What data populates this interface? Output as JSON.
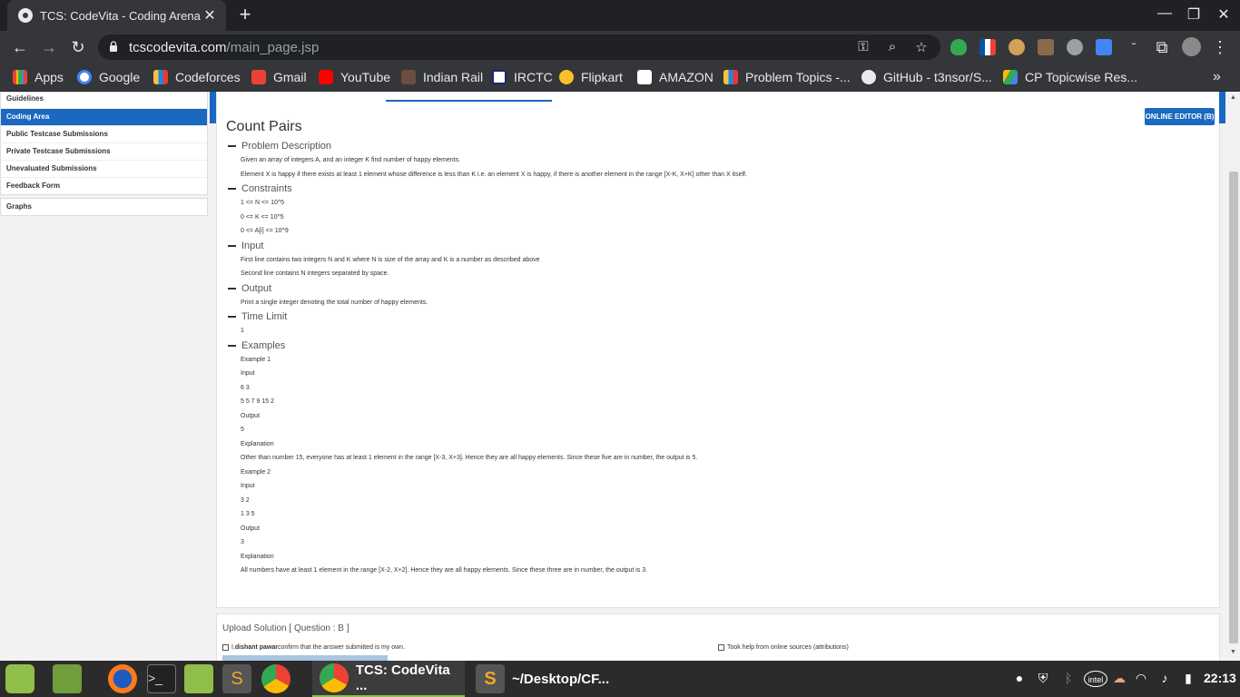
{
  "browser": {
    "tab_title": "TCS: CodeVita - Coding Arena",
    "url_domain": "tcscodevita.com",
    "url_path": "/main_page.jsp",
    "bookmarks": [
      "Apps",
      "Google",
      "Codeforces",
      "Gmail",
      "YouTube",
      "Indian Rail",
      "IRCTC",
      "Flipkart",
      "AMAZON",
      "Problem Topics -...",
      "GitHub - t3nsor/S...",
      "CP Topicwise Res..."
    ],
    "icons": {
      "favicon": "globe-icon",
      "close": "close-icon",
      "new_tab": "plus-icon",
      "minimize": "minimize-icon",
      "restore": "restore-icon",
      "window_close": "close-icon",
      "back": "arrow-left-icon",
      "forward": "arrow-right-icon",
      "reload": "reload-icon",
      "lock": "lock-icon",
      "key": "key-icon",
      "zoom": "zoom-icon",
      "star": "star-icon",
      "extensions": "puzzle-icon",
      "menu": "kebab-menu-icon",
      "more_bookmarks": "chevron-double-right-icon"
    }
  },
  "sidebar": {
    "items": [
      "Guidelines",
      "Coding Area",
      "Public Testcase Submissions",
      "Private Testcase Submissions",
      "Unevaluated Submissions",
      "Feedback Form"
    ],
    "active_index": 1,
    "extra": "Graphs"
  },
  "problem": {
    "title": "Count Pairs",
    "editor_button": "ONLINE EDITOR (B)",
    "sections": [
      {
        "heading": "Problem Description",
        "lines": [
          "Given an array of integers A, and an integer K find number of happy elements.",
          "Element X is happy if there exists at least 1 element whose difference is less than K i.e. an element X is happy, if there is another element in the range [X-K, X+K] other than X itself."
        ]
      },
      {
        "heading": "Constraints",
        "lines": [
          "1 <= N <= 10^5",
          "0 <= K <= 10^5",
          "0 <= A[i] <= 10^9"
        ]
      },
      {
        "heading": "Input",
        "lines": [
          "First line contains two integers N and K where N is size of the array and K is a number as described above",
          "Second line contains N integers separated by space."
        ]
      },
      {
        "heading": "Output",
        "lines": [
          "Print a single integer denoting the total number of happy elements."
        ]
      },
      {
        "heading": "Time Limit",
        "lines": [
          "1"
        ]
      },
      {
        "heading": "Examples",
        "lines": [
          "Example 1",
          "Input",
          "6 3",
          "5 5 7 9 15 2",
          "Output",
          "5",
          "Explanation",
          "Other than number 15, everyone has at least 1 element in the range [X-3, X+3]. Hence they are all happy elements. Since these five are in number, the output is 5.",
          "Example 2",
          "Input",
          "3 2",
          "1 3 5",
          "Output",
          "3",
          "Explanation",
          "All numbers have at least 1 element in the range [X-2, X+2]. Hence they are all happy elements. Since these three are in number, the output is 3."
        ]
      }
    ]
  },
  "upload": {
    "title": "Upload Solution [ Question : B ]",
    "confirm_prefix": "I, ",
    "confirm_name": "dishant pawar",
    "confirm_suffix": " confirm that the answer submitted is my own.",
    "help_label": "Took help from online sources (attributions)"
  },
  "taskbar": {
    "windows": [
      "TCS: CodeVita ...",
      "~/Desktop/CF..."
    ],
    "active_index": 0,
    "clock": "22:13",
    "tray_icons": [
      "user-icon",
      "shield-icon",
      "bluetooth-icon",
      "intel-icon",
      "weather-icon",
      "wifi-icon",
      "music-icon",
      "battery-icon"
    ]
  },
  "colors": {
    "accent": "#1a68c0",
    "chrome_dark": "#202124",
    "chrome_toolbar": "#35363a",
    "taskbar": "#2b2b2b"
  }
}
